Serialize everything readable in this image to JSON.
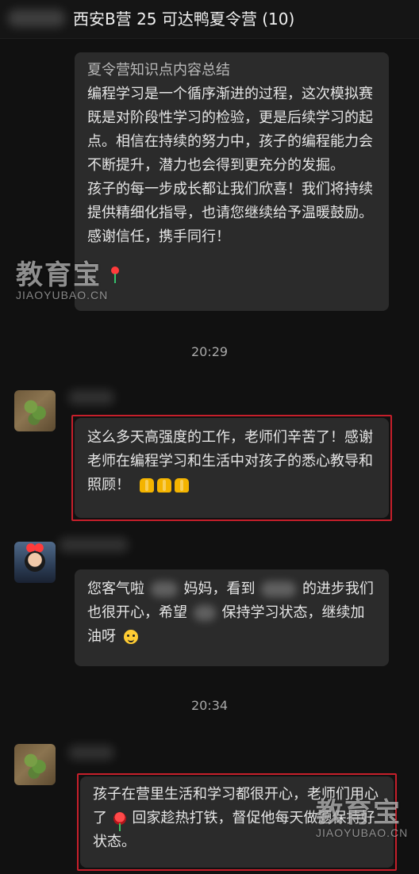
{
  "header": {
    "title": "西安B营 25 可达鸭夏令营 (10)"
  },
  "messages": {
    "top_partial": {
      "line0": "夏令营知识点内容总结",
      "paragraph1": "编程学习是一个循序渐进的过程，这次模拟赛既是对阶段性学习的检验，更是后续学习的起点。相信在持续的努力中，孩子的编程能力会不断提升，潜力也会得到更充分的发掘。",
      "paragraph2": "孩子的每一步成长都让我们欣喜！我们将持续提供精细化指导，也请您继续给予温暖鼓励。感谢信任，携手同行！"
    },
    "time1": "20:29",
    "msg_thanks": "这么多天高强度的工作，老师们辛苦了！感谢老师在编程学习和生活中对孩子的悉心教导和照顾！",
    "msg_reply": {
      "text1": "您客气啦",
      "text2": "妈妈，看到",
      "text3": "的进步我们也很开心，希望",
      "text4": "保持学习状态，继续加油呀"
    },
    "time2": "20:34",
    "msg_bottom": {
      "text1": "孩子在营里生活和学习都很开心，老师们用心了",
      "text2": "回家趁热打铁，督促他每天做题保持好状态。"
    }
  },
  "watermark": {
    "main": "教育宝",
    "sub": "JIAOYUBAO.CN"
  },
  "colors": {
    "background": "#111111",
    "bubble": "#2b2b2b",
    "highlight": "#c61f2b"
  },
  "icons": {
    "pray": "pray-hands-icon",
    "rose": "rose-icon",
    "smile": "smile-icon"
  }
}
